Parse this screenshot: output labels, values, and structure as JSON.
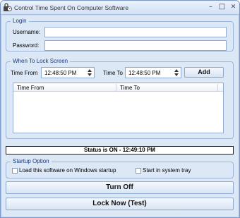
{
  "window": {
    "title": "Control Time Spent On Computer Software"
  },
  "login": {
    "legend": "Login",
    "username_label": "Username:",
    "username_value": "",
    "password_label": "Password:",
    "password_value": ""
  },
  "lock_screen": {
    "legend": "When To Lock Screen",
    "time_from_label": "Time From",
    "time_from_value": "12:48:50 PM",
    "time_to_label": "Time To",
    "time_to_value": "12:48:50 PM",
    "add_label": "Add",
    "columns": [
      "Time From",
      "Time To"
    ],
    "rows": []
  },
  "status": {
    "text": "Status is ON - 12:49:10 PM"
  },
  "startup": {
    "legend": "Startup Option",
    "load_label": "Load this software on Windows startup",
    "load_checked": false,
    "tray_label": "Start in system tray",
    "tray_checked": false
  },
  "buttons": {
    "turn_off": "Turn Off",
    "lock_now": "Lock Now (Test)"
  },
  "colors": {
    "window_bg": "#dde8f7",
    "accent": "#1c3a78",
    "border": "#9bb4d8"
  },
  "icons": {
    "app": "padlock-clock-icon",
    "minimize": "minimize-icon",
    "maximize": "maximize-icon",
    "close": "close-icon"
  }
}
